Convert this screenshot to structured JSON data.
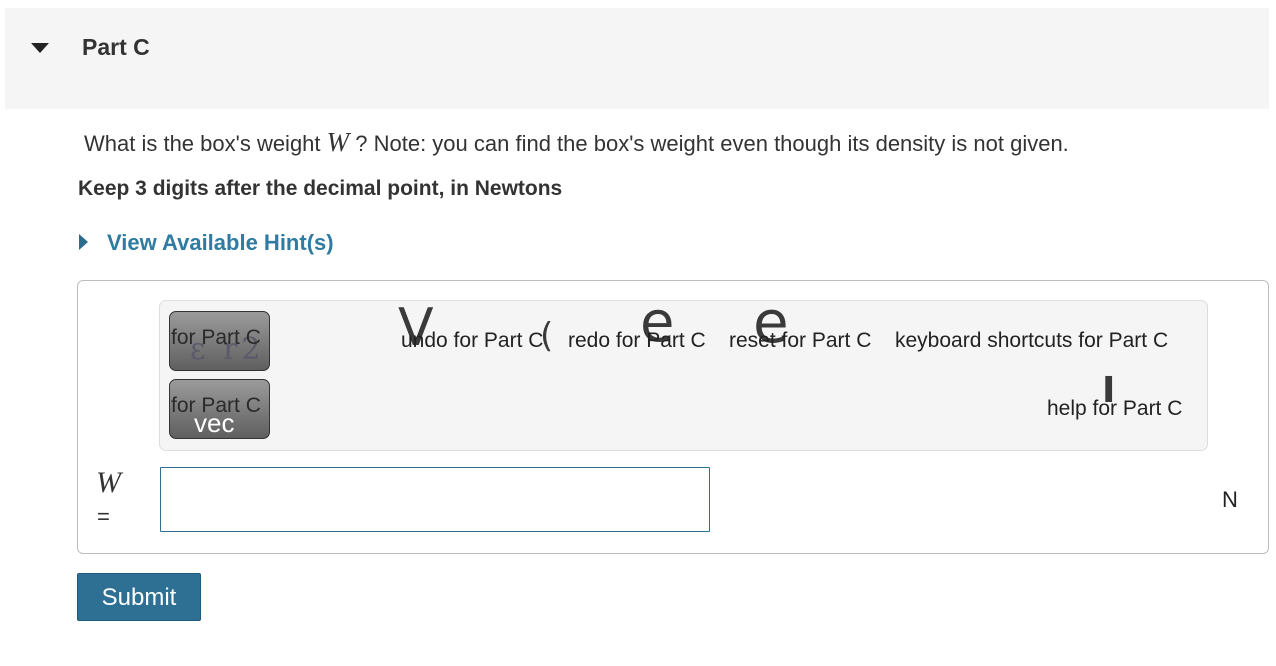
{
  "part": {
    "title": "Part C"
  },
  "question": {
    "prefix": "What is the box's weight ",
    "variable": "W",
    "suffix": " ? Note: you can find the box's weight even though its density is not given.",
    "instruction": "Keep 3 digits after the decimal point, in Newtons"
  },
  "hint": {
    "label": "View Available Hint(s)"
  },
  "toolbar": {
    "templates_button_label": "for Part C",
    "templates_button_glyphs": "ε r2",
    "vector_button_label": "for Part C",
    "vector_button_glyph": "vec",
    "undo_label": "undo for Part C",
    "redo_label": "redo for Part C",
    "reset_label": "reset for Part C",
    "keyboard_label": "keyboard shortcuts for Part C",
    "help_label": "help for Part C"
  },
  "answer": {
    "variable": "W",
    "equals": "=",
    "value": "",
    "unit": "N"
  },
  "submit": {
    "label": "Submit"
  },
  "colors": {
    "link": "#2f7ba1",
    "submit_bg": "#2d7094",
    "header_bg": "#f5f5f5"
  }
}
